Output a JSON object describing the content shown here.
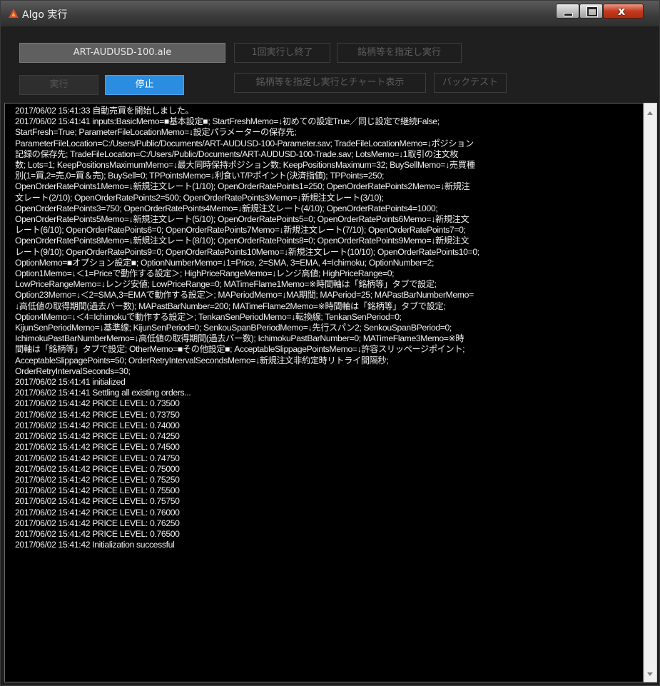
{
  "window": {
    "title": "Algo 実行",
    "close_glyph": "x"
  },
  "toolbar": {
    "file_label": "ART-AUDUSD-100.ale",
    "run_once_label": "1回実行し終了",
    "run_symbol_label": "銘柄等を指定し実行",
    "run_label": "実行",
    "stop_label": "停止",
    "run_symbol_chart_label": "銘柄等を指定し実行とチャート表示",
    "backtest_label": "バックテスト"
  },
  "log": {
    "lines": [
      "2017/06/02 15:41:33 自動売買を開始しました。",
      "2017/06/02 15:41:41 inputs:BasicMemo=■基本設定■; StartFreshMemo=↓初めての設定True／同じ設定で継続False;",
      "StartFresh=True; ParameterFileLocationMemo=↓設定パラメーターの保存先;",
      "ParameterFileLocation=C:/Users/Public/Documents/ART-AUDUSD-100-Parameter.sav; TradeFileLocationMemo=↓ポジション",
      "記録の保存先; TradeFileLocation=C:/Users/Public/Documents/ART-AUDUSD-100-Trade.sav; LotsMemo=↓1取引の注文枚",
      "数; Lots=1; KeepPositionsMaximumMemo=↓最大同時保持ポジション数; KeepPositionsMaximum=32; BuySellMemo=↓売買種",
      "別(1=買,2=売,0=買＆売); BuySell=0; TPPointsMemo=↓利食いT/Pポイント(決済指値); TPPoints=250;",
      "OpenOrderRatePoints1Memo=↓新規注文レート(1/10); OpenOrderRatePoints1=250; OpenOrderRatePoints2Memo=↓新規注",
      "文レート(2/10); OpenOrderRatePoints2=500; OpenOrderRatePoints3Memo=↓新規注文レート(3/10);",
      "OpenOrderRatePoints3=750; OpenOrderRatePoints4Memo=↓新規注文レート(4/10); OpenOrderRatePoints4=1000;",
      "OpenOrderRatePoints5Memo=↓新規注文レート(5/10); OpenOrderRatePoints5=0; OpenOrderRatePoints6Memo=↓新規注文",
      "レート(6/10); OpenOrderRatePoints6=0; OpenOrderRatePoints7Memo=↓新規注文レート(7/10); OpenOrderRatePoints7=0;",
      "OpenOrderRatePoints8Memo=↓新規注文レート(8/10); OpenOrderRatePoints8=0; OpenOrderRatePoints9Memo=↓新規注文",
      "レート(9/10); OpenOrderRatePoints9=0; OpenOrderRatePoints10Memo=↓新規注文レート(10/10); OpenOrderRatePoints10=0;",
      "OptionMemo=■オプション設定■; OptionNumberMemo=↓1=Price, 2=SMA, 3=EMA, 4=Ichimoku; OptionNumber=2;",
      "Option1Memo=↓＜1=Priceで動作する設定＞; HighPriceRangeMemo=↓レンジ高値; HighPriceRange=0;",
      "LowPriceRangeMemo=↓レンジ安値; LowPriceRange=0; MATimeFlame1Memo=※時間軸は「銘柄等」タブで設定;",
      "Option23Memo=↓＜2=SMA,3=EMAで動作する設定＞; MAPeriodMemo=↓MA期間; MAPeriod=25; MAPastBarNumberMemo=",
      "↓高低値の取得期間(過去バー数); MAPastBarNumber=200; MATimeFlame2Memo=※時間軸は「銘柄等」タブで設定;",
      "Option4Memo=↓＜4=Ichimokuで動作する設定＞; TenkanSenPeriodMemo=↓転換線; TenkanSenPeriod=0;",
      "KijunSenPeriodMemo=↓基準線; KijunSenPeriod=0; SenkouSpanBPeriodMemo=↓先行スパン2; SenkouSpanBPeriod=0;",
      "IchimokuPastBarNumberMemo=↓高低値の取得期間(過去バー数); IchimokuPastBarNumber=0; MATimeFlame3Memo=※時",
      "間軸は「銘柄等」タブで設定; OtherMemo=■その他設定■; AcceptableSlippagePointsMemo=↓許容スリッページポイント;",
      "AcceptableSlippagePoints=50; OrderRetryIntervalSecondsMemo=↓新規注文非約定時リトライ間隔秒;",
      "OrderRetryIntervalSeconds=30;",
      "2017/06/02 15:41:41 initialized",
      "2017/06/02 15:41:41 Settling all existing orders...",
      "2017/06/02 15:41:42 PRICE LEVEL: 0.73500",
      "2017/06/02 15:41:42 PRICE LEVEL: 0.73750",
      "2017/06/02 15:41:42 PRICE LEVEL: 0.74000",
      "2017/06/02 15:41:42 PRICE LEVEL: 0.74250",
      "2017/06/02 15:41:42 PRICE LEVEL: 0.74500",
      "2017/06/02 15:41:42 PRICE LEVEL: 0.74750",
      "2017/06/02 15:41:42 PRICE LEVEL: 0.75000",
      "2017/06/02 15:41:42 PRICE LEVEL: 0.75250",
      "2017/06/02 15:41:42 PRICE LEVEL: 0.75500",
      "2017/06/02 15:41:42 PRICE LEVEL: 0.75750",
      "2017/06/02 15:41:42 PRICE LEVEL: 0.76000",
      "2017/06/02 15:41:42 PRICE LEVEL: 0.76250",
      "2017/06/02 15:41:42 PRICE LEVEL: 0.76500",
      "2017/06/02 15:41:42 Initialization successful"
    ]
  },
  "colors": {
    "accent_blue": "#2a8de0",
    "close_red": "#c43b1e",
    "log_bg": "#000000"
  },
  "icons": {
    "app": "algo-app-icon",
    "scroll_up": "scroll-up-arrow-icon",
    "scroll_down": "scroll-down-arrow-icon"
  }
}
